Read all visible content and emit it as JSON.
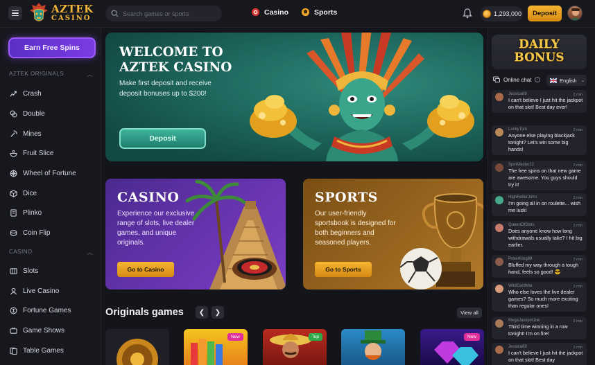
{
  "header": {
    "logo_main": "AZTEK",
    "logo_sub": "CASINO",
    "search_placeholder": "Search games or sports",
    "nav_casino": "Casino",
    "nav_sports": "Sports",
    "balance": "1,293,000",
    "deposit_label": "Deposit"
  },
  "sidebar": {
    "earn_label": "Earn Free Spins",
    "section_originals": "AZTEK ORIGINALS",
    "originals": [
      {
        "label": "Crash",
        "icon": "crash-icon"
      },
      {
        "label": "Double",
        "icon": "double-icon"
      },
      {
        "label": "Mines",
        "icon": "mines-icon"
      },
      {
        "label": "Fruit Slice",
        "icon": "fruit-icon"
      },
      {
        "label": "Wheel of Fortune",
        "icon": "wheel-icon"
      },
      {
        "label": "Dice",
        "icon": "dice-icon"
      },
      {
        "label": "Plinko",
        "icon": "plinko-icon"
      },
      {
        "label": "Coin Flip",
        "icon": "coin-icon"
      }
    ],
    "section_casino": "CASINO",
    "casino": [
      {
        "label": "Slots",
        "icon": "slots-icon"
      },
      {
        "label": "Live Casino",
        "icon": "live-casino-icon"
      },
      {
        "label": "Fortune Games",
        "icon": "fortune-icon"
      },
      {
        "label": "Game Shows",
        "icon": "game-shows-icon"
      },
      {
        "label": "Table Games",
        "icon": "table-games-icon"
      }
    ]
  },
  "welcome": {
    "title": "WELCOME TO AZTEK CASINO",
    "text": "Make first deposit and receive deposit bonuses up to $200!",
    "button": "Deposit"
  },
  "casino_promo": {
    "title": "CASINO",
    "text": "Experience our exclusive range of slots, live dealer games, and unique originals.",
    "button": "Go to Casino"
  },
  "sports_promo": {
    "title": "SPORTS",
    "text": "Our user-friendly sportsbook is designed for both beginners and seasoned players.",
    "button": "Go to Sports"
  },
  "originals": {
    "title": "Originals games",
    "view_all": "View all",
    "badges": [
      "New",
      "Top",
      "New"
    ]
  },
  "right_panel": {
    "daily_line1": "DAILY",
    "daily_line2": "BONUS",
    "chat_title": "Online chat",
    "language": "English",
    "messages": [
      {
        "user": "Jessica69",
        "time": "2 min",
        "text": "I can't believe I just hit the jackpot on that slot! Best day ever!"
      },
      {
        "user": "LuckyTom",
        "time": "2 min",
        "text": "Anyone else playing blackjack tonight? Let's win some big hands!"
      },
      {
        "user": "SpinMaster22",
        "time": "2 min",
        "text": "The free spins on that new game are awesome. You guys should try it!"
      },
      {
        "user": "HighRollerJohn",
        "time": "2 min",
        "text": "I'm going all in on roulette... wish me luck!"
      },
      {
        "user": "QueenOfSlots",
        "time": "2 min",
        "text": "Does anyone know how long withdrawals usually take? I hit big earlier."
      },
      {
        "user": "PokerKing88",
        "time": "2 min",
        "text": "Bluffed my way through a tough hand, feels so good! 😎"
      },
      {
        "user": "WildCardMia",
        "time": "2 min",
        "text": "Who else loves the live dealer games? So much more exciting than regular ones!"
      },
      {
        "user": "MegaJackpotJoe",
        "time": "2 min",
        "text": "Third time winning in a row tonight! I'm on fire!"
      },
      {
        "user": "Jessica69",
        "time": "2 min",
        "text": "I can't believe I just hit the jackpot on that slot! Best day"
      }
    ]
  },
  "colors": {
    "accent_gold": "#f0b63c",
    "button_gold": "#e5a024",
    "purple": "#7a3be3",
    "teal": "#2f8a7a"
  }
}
